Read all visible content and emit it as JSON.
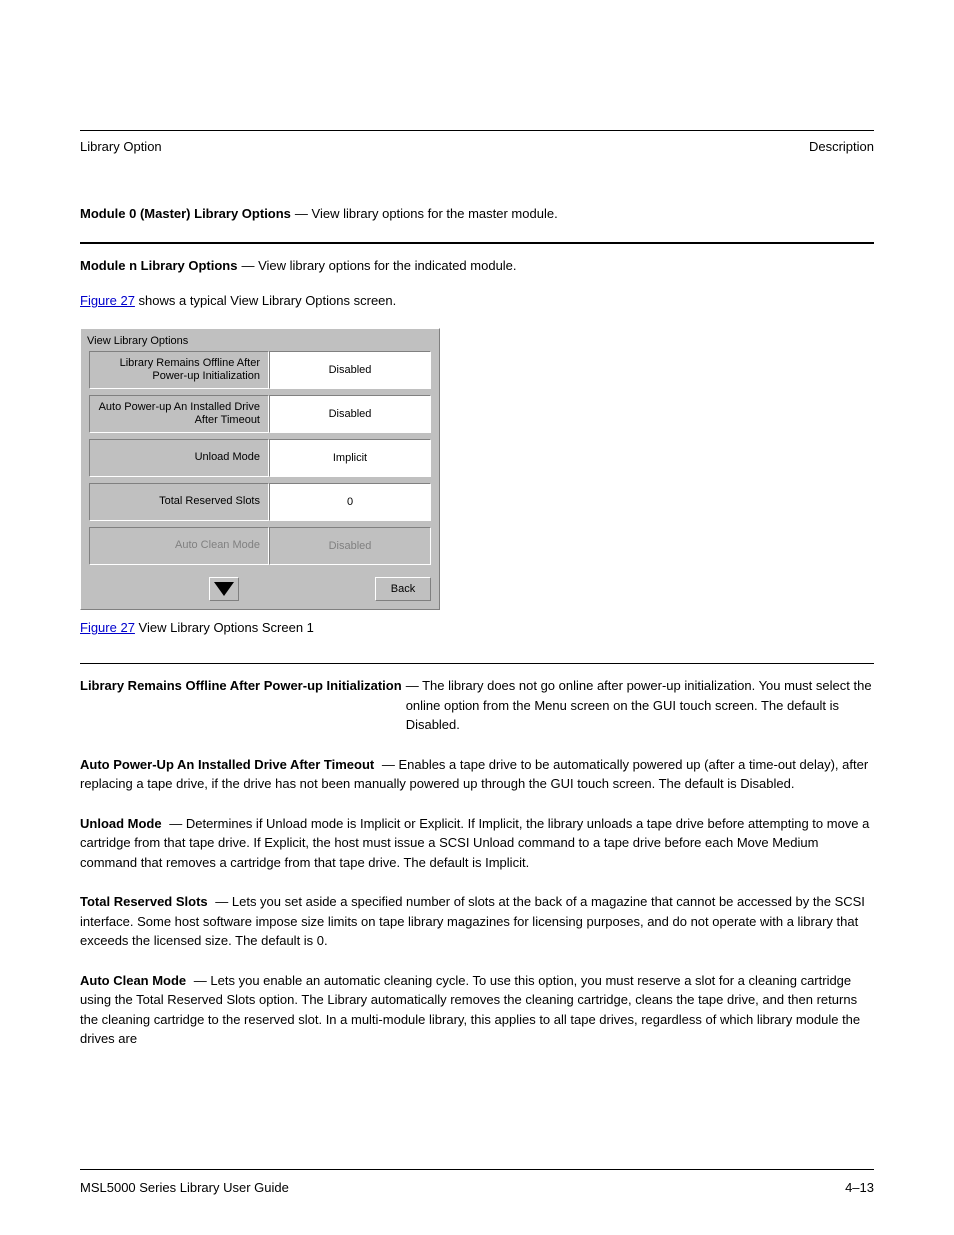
{
  "header": {
    "left": "Library Option",
    "right": "Description"
  },
  "module0": {
    "name": "Module 0 (Master) Library Options",
    "desc": "— View library options for the master module."
  },
  "moduleN": {
    "name": "Module n Library Options",
    "desc": "— View library options for the indicated module.",
    "figref_pre": "Figure 27",
    "figref_post": " shows a typical View Library Options screen."
  },
  "screen": {
    "title": "View Library Options",
    "rows": [
      {
        "label": "Library Remains Offline After Power-up Initialization",
        "value": "Disabled"
      },
      {
        "label": "Auto Power-up An Installed Drive After Timeout",
        "value": "Disabled"
      },
      {
        "label": "Unload Mode",
        "value": "Implicit"
      },
      {
        "label": "Total Reserved Slots",
        "value": "0"
      },
      {
        "label": "Auto Clean Mode",
        "value": "Disabled"
      }
    ],
    "back": "Back"
  },
  "figure": {
    "num": "Figure 27",
    "sep": "   ",
    "title": "View Library Options Screen 1"
  },
  "options": [
    {
      "name": "Library Remains Offline After Power-up Initialization",
      "desc": "— The library does not go online after power-up initialization. You must select the online option from the Menu screen on the GUI touch screen. The default is Disabled."
    },
    {
      "name": "Auto Power-Up An Installed Drive After Timeout",
      "desc": "— Enables a tape drive to be automatically powered up (after a time-out delay), after replacing a tape drive, if the drive has not been manually powered up through the GUI touch screen. The default is Disabled."
    },
    {
      "name": "Unload Mode",
      "desc": "— Determines if Unload mode is Implicit or Explicit. If Implicit, the library unloads a tape drive before attempting to move a cartridge from that tape drive. If Explicit, the host must issue a SCSI Unload command to a tape drive before each Move Medium command that removes a cartridge from that tape drive. The default is Implicit."
    },
    {
      "name": "Total Reserved Slots",
      "desc": "— Lets you set aside a specified number of slots at the back of a magazine that cannot be accessed by the SCSI interface. Some host software impose size limits on tape library magazines for licensing purposes, and do not operate with a library that exceeds the licensed size. The default is 0."
    },
    {
      "name": "Auto Clean Mode",
      "desc": "— Lets you enable an automatic cleaning cycle. To use this option, you must reserve a slot for a cleaning cartridge using the Total Reserved Slots option. The Library automatically removes the cleaning cartridge, cleans the tape drive, and then returns the cleaning cartridge to the reserved slot. In a multi-module library, this applies to all tape drives, regardless of which library module the drives are"
    }
  ],
  "footer": {
    "left": "MSL5000 Series Library User Guide",
    "right": "4–13"
  }
}
